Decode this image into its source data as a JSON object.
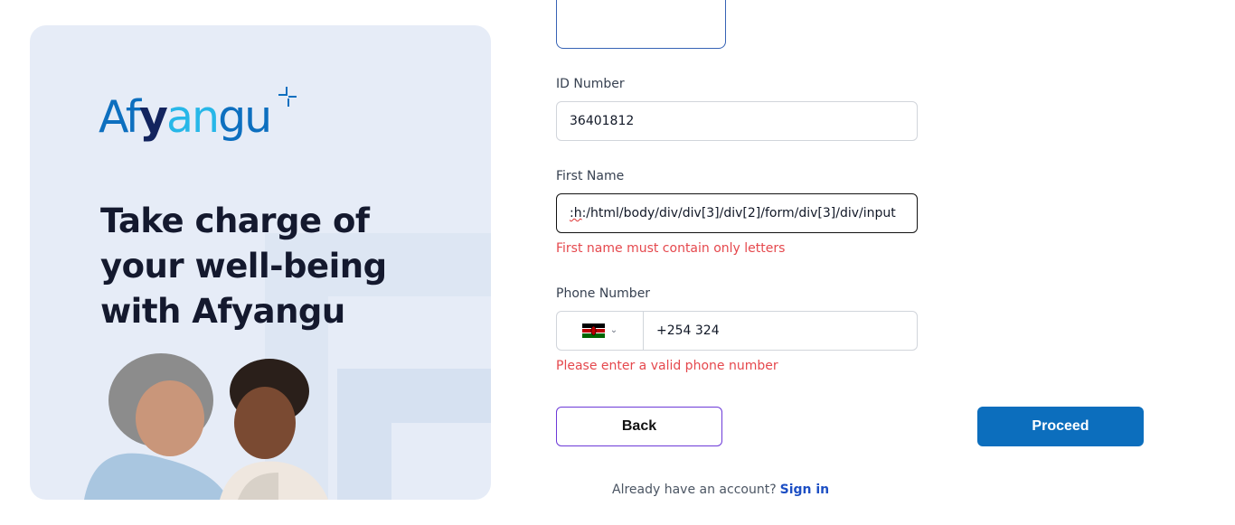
{
  "brand": {
    "logo_parts": [
      "Af",
      "y",
      "an",
      "gu"
    ],
    "colors": {
      "primary": "#0c6ebd",
      "dark": "#13245e",
      "cyan": "#27b7e8",
      "error": "#e5484d",
      "link": "#1d4fc4",
      "accent_border": "#6d3ad8"
    }
  },
  "hero": {
    "headline_lines": [
      "Take charge of",
      "your well-being",
      "with Afyangu"
    ]
  },
  "form": {
    "id_number": {
      "label": "ID Number",
      "value": "36401812"
    },
    "first_name": {
      "label": "First Name",
      "value_prefix": ":h",
      "value_rest": ":/html/body/div/div[3]/div[2]/form/div[3]/div/input",
      "error": "First name must contain only letters"
    },
    "phone": {
      "label": "Phone Number",
      "country_flag_icon": "kenya-flag-icon",
      "value": "+254 324",
      "error": "Please enter a valid phone number"
    }
  },
  "actions": {
    "back_label": "Back",
    "proceed_label": "Proceed"
  },
  "footer": {
    "prompt": "Already have an account?",
    "signin_label": "Sign in"
  }
}
